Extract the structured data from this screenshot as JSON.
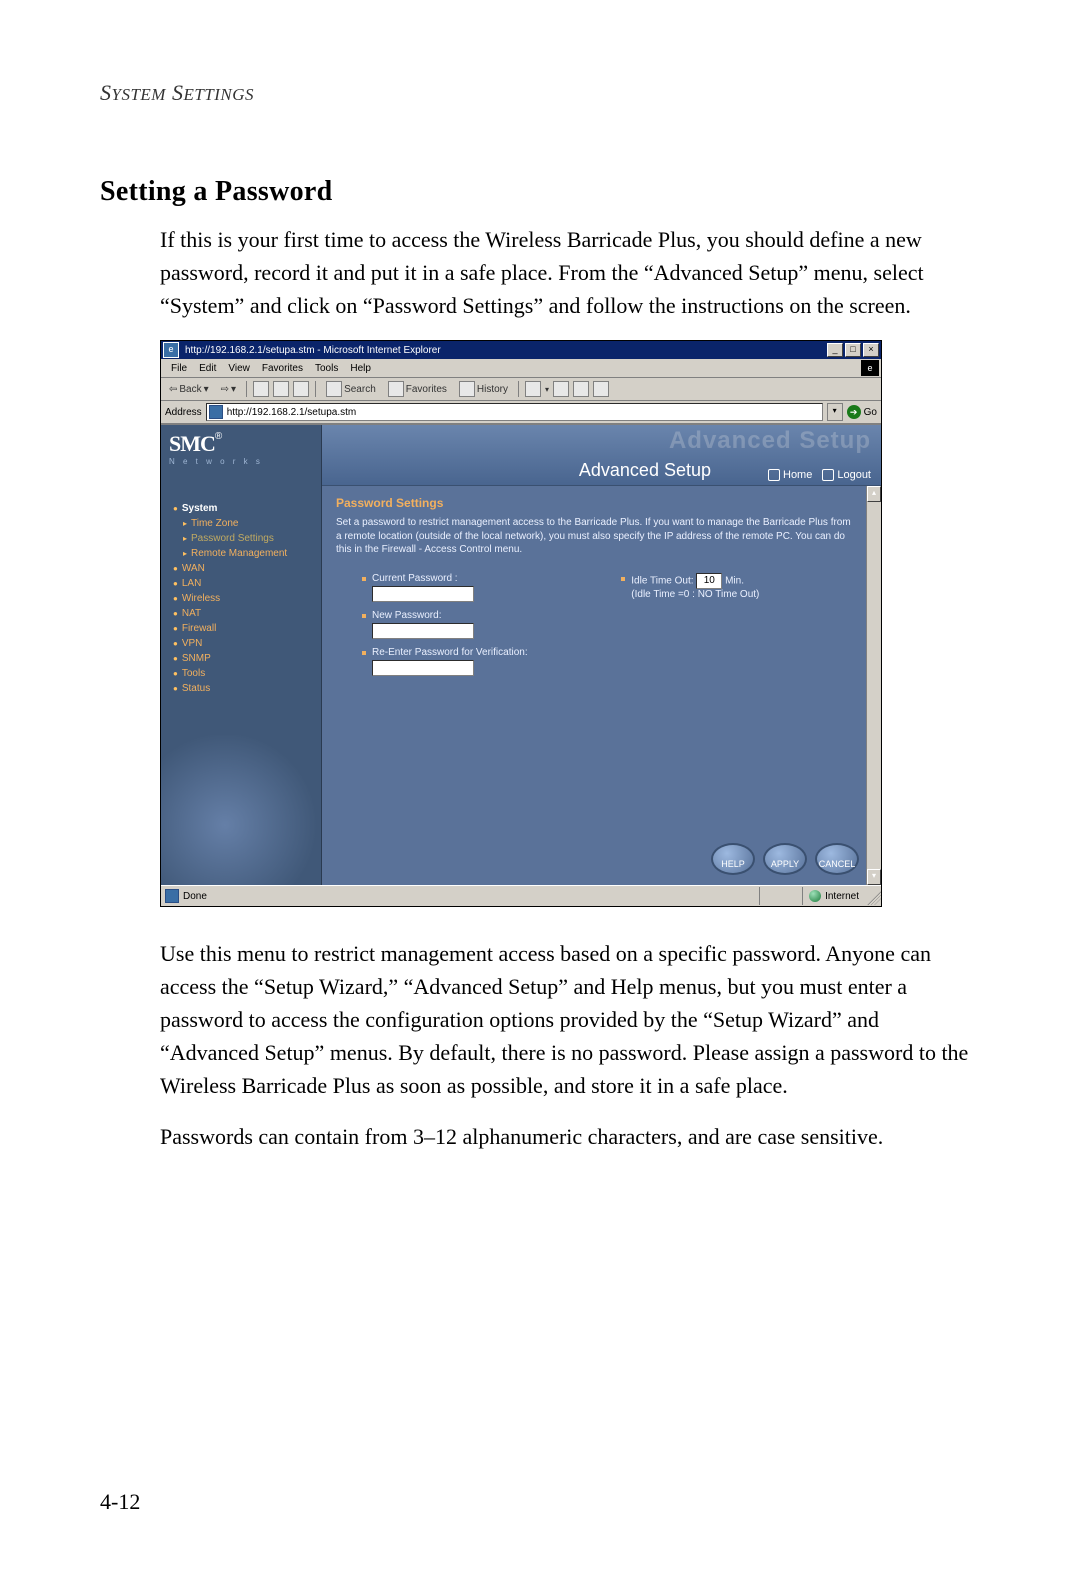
{
  "page": {
    "running_header": "System Settings",
    "section_title": "Setting a Password",
    "intro_paragraph": "If this is your first time to access the Wireless Barricade Plus, you should define a new password, record it and put it in a safe place. From the “Advanced Setup” menu, select “System” and click on “Password Settings” and follow the instructions on the screen.",
    "after_paragraph_1": "Use this menu to restrict management access based on a specific password. Anyone can access the “Setup Wizard,” “Advanced Setup” and Help menus, but you must enter a password to access the configuration options provided by the “Setup Wizard” and “Advanced Setup” menus. By default, there is no password. Please assign a password to the Wireless Barricade Plus as soon as possible, and store it in a safe place.",
    "after_paragraph_2": "Passwords can contain from 3–12 alphanumeric characters, and are case sensitive.",
    "page_number": "4-12"
  },
  "browser": {
    "title": "http://192.168.2.1/setupa.stm - Microsoft Internet Explorer",
    "window_buttons": {
      "minimize": "_",
      "maximize": "□",
      "close": "×"
    },
    "menu": {
      "file": "File",
      "edit": "Edit",
      "view": "View",
      "favorites": "Favorites",
      "tools": "Tools",
      "help": "Help"
    },
    "toolbar": {
      "back": "Back",
      "search": "Search",
      "favorites": "Favorites",
      "history": "History"
    },
    "addressbar": {
      "label": "Address",
      "url": "http://192.168.2.1/setupa.stm",
      "go": "Go"
    },
    "statusbar": {
      "done": "Done",
      "zone": "Internet"
    }
  },
  "router_ui": {
    "brand": {
      "name": "SMC",
      "sup": "®",
      "sub": "N e t w o r k s"
    },
    "banner": {
      "watermark": "Advanced Setup",
      "title": "Advanced Setup",
      "home": "Home",
      "logout": "Logout"
    },
    "nav": {
      "system": "System",
      "time_zone": "Time Zone",
      "password_settings": "Password Settings",
      "remote_management": "Remote Management",
      "wan": "WAN",
      "lan": "LAN",
      "wireless": "Wireless",
      "nat": "NAT",
      "firewall": "Firewall",
      "vpn": "VPN",
      "snmp": "SNMP",
      "tools": "Tools",
      "status": "Status"
    },
    "panel": {
      "title": "Password Settings",
      "description": "Set a password to restrict management access to the Barricade Plus. If you want to manage the Barricade Plus from a remote location (outside of the local network), you must also specify the IP address of the remote PC. You can do this in the Firewall - Access Control menu.",
      "current_password": "Current Password :",
      "new_password": "New Password:",
      "reenter_password": "Re-Enter Password for Verification:",
      "idle_time_out_label": "Idle Time Out:",
      "idle_time_out_value": "10",
      "idle_unit": "Min.",
      "idle_note": "(Idle Time =0 : NO Time Out)"
    },
    "buttons": {
      "help": "HELP",
      "apply": "APPLY",
      "cancel": "CANCEL"
    }
  }
}
